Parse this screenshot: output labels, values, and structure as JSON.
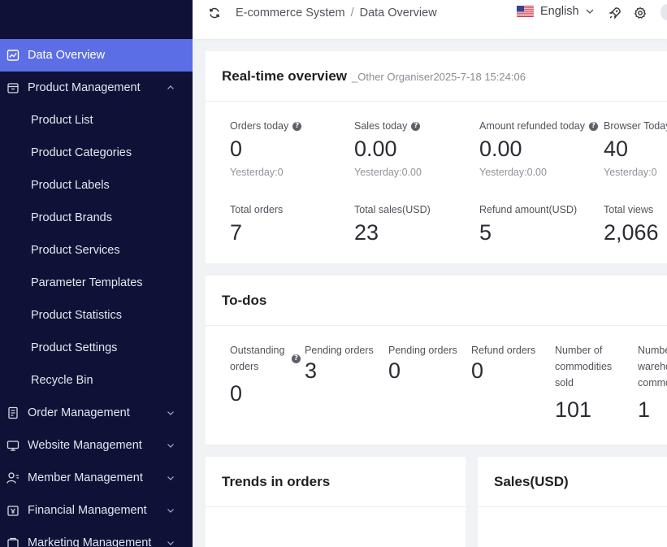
{
  "sidebar": {
    "items": [
      {
        "label": "Data Overview"
      },
      {
        "label": "Product Management"
      },
      {
        "label": "Product List"
      },
      {
        "label": "Product Categories"
      },
      {
        "label": "Product Labels"
      },
      {
        "label": "Product Brands"
      },
      {
        "label": "Product Services"
      },
      {
        "label": "Parameter Templates"
      },
      {
        "label": "Product Statistics"
      },
      {
        "label": "Product Settings"
      },
      {
        "label": "Recycle Bin"
      },
      {
        "label": "Order Management"
      },
      {
        "label": "Website Management"
      },
      {
        "label": "Member Management"
      },
      {
        "label": "Financial Management"
      },
      {
        "label": "Marketing Management"
      }
    ]
  },
  "header": {
    "breadcrumb": [
      "E-commerce System",
      "Data Overview"
    ],
    "breadcrumb_separator": "/",
    "language": "English"
  },
  "realtime": {
    "title": "Real-time overview",
    "subtitle": "_Other Organiser2025-7-18 15:24:06",
    "today": [
      {
        "label": "Orders today",
        "value": "0",
        "yesterday": "Yesterday:0"
      },
      {
        "label": "Sales today",
        "value": "0.00",
        "yesterday": "Yesterday:0.00"
      },
      {
        "label": "Amount refunded today",
        "value": "0.00",
        "yesterday": "Yesterday:0.00"
      },
      {
        "label": "Browser Today",
        "value": "40",
        "yesterday": "Yesterday:0"
      }
    ],
    "totals": [
      {
        "label": "Total orders",
        "value": "7"
      },
      {
        "label": "Total sales(USD)",
        "value": "23"
      },
      {
        "label": "Refund amount(USD)",
        "value": "5"
      },
      {
        "label": "Total views",
        "value": "2,066"
      }
    ]
  },
  "todos": {
    "title": "To-dos",
    "items": [
      {
        "label": "Outstanding orders",
        "value": "0"
      },
      {
        "label": "Pending orders",
        "value": "3"
      },
      {
        "label": "Pending orders",
        "value": "0"
      },
      {
        "label": "Refund orders",
        "value": "0"
      },
      {
        "label": "Number of commodities sold",
        "value": "101"
      },
      {
        "label": "Number of warehouse commodities",
        "value": "1"
      }
    ]
  },
  "trends": {
    "title": "Trends in orders"
  },
  "sales": {
    "title": "Sales(USD)"
  },
  "colors": {
    "sidebar_bg": "#0f1136",
    "active_item": "#5b6ee6",
    "page_bg": "#f0f2f5"
  },
  "icons": [
    "chart-icon",
    "box-icon",
    "order-icon",
    "website-icon",
    "member-icon",
    "wallet-icon",
    "marketing-icon",
    "refresh-icon",
    "us-flag-icon",
    "rocket-icon",
    "gear-icon",
    "help-icon"
  ]
}
